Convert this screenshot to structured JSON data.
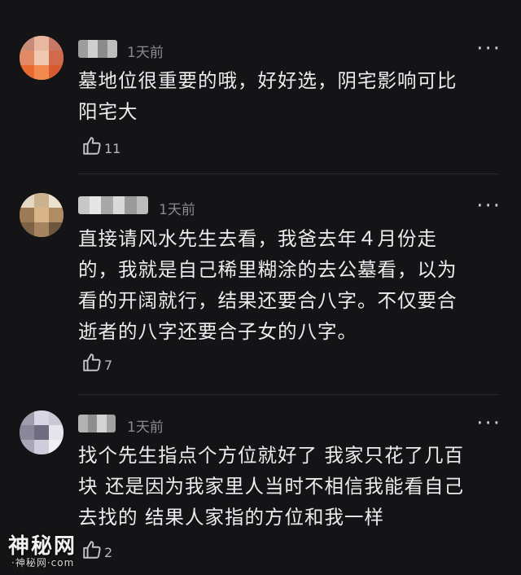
{
  "comments": [
    {
      "time": "1天前",
      "text": "墓地位很重要的哦，好好选，阴宅影响可比\n阳宅大",
      "likes": "11",
      "more": "···"
    },
    {
      "time": "1天前",
      "text": "直接请风水先生去看，我爸去年４月份走\n的，我就是自己稀里糊涂的去公墓看，以为\n看的开阔就行，结果还要合八字。不仅要合\n逝者的八字还要合子女的八字。",
      "likes": "7",
      "more": "···"
    },
    {
      "time": "1天前",
      "text": "找个先生指点个方位就好了 我家只花了几百\n块 还是因为我家里人当时不相信我能看自己\n去找的 结果人家指的方位和我一样",
      "likes": "2",
      "more": "···"
    }
  ],
  "watermark": {
    "title": "神秘网",
    "subtitle": "·神秘网·com"
  },
  "colors": {
    "background": "#141416",
    "text": "#ececee",
    "meta": "#8a8a8f"
  }
}
